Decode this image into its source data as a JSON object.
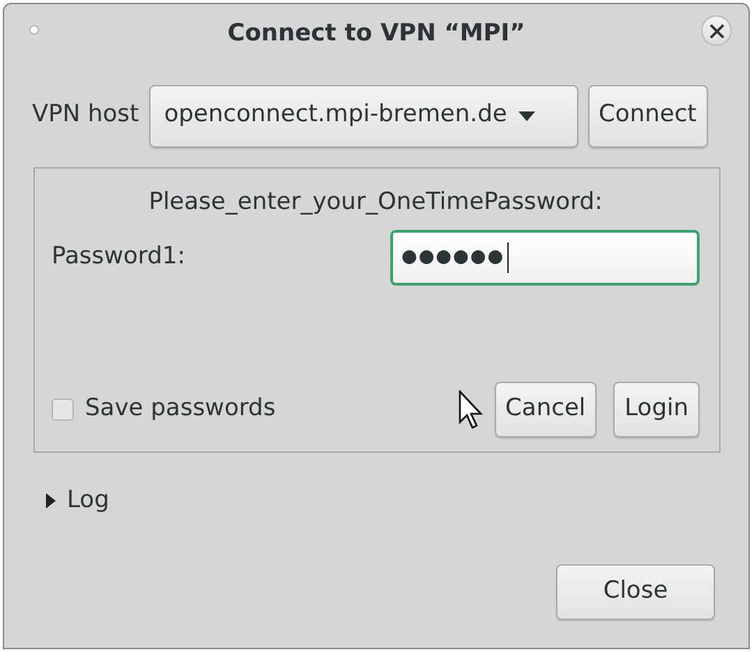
{
  "window": {
    "title": "Connect to VPN “MPI”"
  },
  "host_row": {
    "label": "VPN host",
    "host": "openconnect.mpi-bremen.de",
    "connect_button": "Connect"
  },
  "login_panel": {
    "prompt": "Please_enter_your_OneTimePassword:",
    "field_label": "Password1:",
    "value": "●●●●●●",
    "focused": true,
    "save_passwords": {
      "label": "Save passwords",
      "checked": false
    },
    "buttons": [
      "Cancel",
      "Login"
    ]
  },
  "log": {
    "label": "Log",
    "expanded": false
  },
  "close_button": "Close"
}
